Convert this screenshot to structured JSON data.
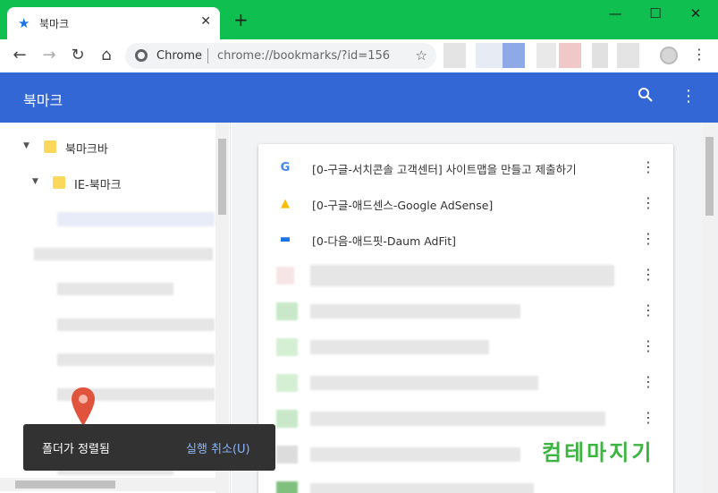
{
  "browser": {
    "tab_title": "북마크",
    "tab_close": "✕",
    "new_tab": "+",
    "window_controls": {
      "minimize": "—",
      "maximize": "☐",
      "close": "✕"
    },
    "nav": {
      "back": "←",
      "forward": "→",
      "reload": "↻",
      "home": "⌂"
    },
    "omnibox": {
      "origin_label": "Chrome",
      "url": "chrome://bookmarks/?id=156"
    },
    "menu": "⋮"
  },
  "bookmarks_app": {
    "title": "북마크",
    "search_icon": "🔍",
    "more_icon": "⋮"
  },
  "tree": {
    "items": [
      {
        "label": "북마크바",
        "arrow": "▼"
      },
      {
        "label": "IE-북마크",
        "arrow": "▼"
      }
    ]
  },
  "list": {
    "items": [
      {
        "label": "[0-구글-서치콘솔 고객센터] 사이트맵을 만들고 제출하기",
        "favicon": "G",
        "favicon_color": "#4285f4",
        "more": "⋮"
      },
      {
        "label": "[0-구글-애드센스-Google AdSense]",
        "favicon": "▲",
        "favicon_color": "#fbbc04",
        "more": "⋮"
      },
      {
        "label": "[0-다음-애드핏-Daum AdFit]",
        "favicon": "▬",
        "favicon_color": "#1a73e8",
        "more": "⋮"
      }
    ]
  },
  "toast": {
    "message": "폴더가 정렬됨",
    "undo": "실행 취소(U)"
  },
  "watermark": "컴테마지기",
  "colors": {
    "tab_strip": "#0fc050",
    "header": "#3367d6",
    "toast_bg": "#323232",
    "toast_action": "#8ab4f8",
    "pin": "#e0533c"
  }
}
